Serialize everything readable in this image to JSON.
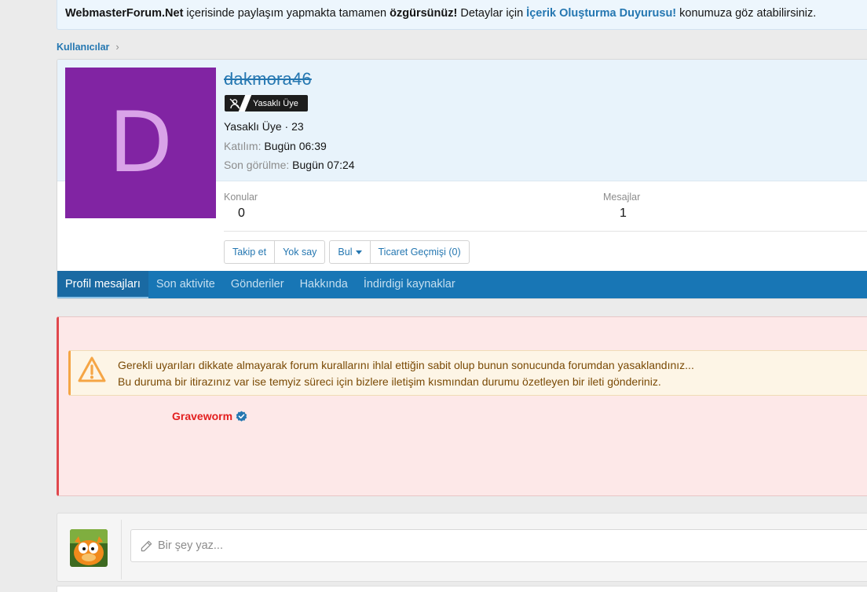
{
  "notice": {
    "site": "WebmasterForum.Net",
    "t1": " içerisinde paylaşım yapmakta tamamen ",
    "bold": "özgürsünüz!",
    "t2": " Detaylar için ",
    "link": "İçerik Oluşturma Duyurusu!",
    "t3": " konumuza göz atabilirsiniz."
  },
  "breadcrumb": {
    "item": "Kullanıcılar",
    "chevron": "›"
  },
  "profile": {
    "avatar_letter": "D",
    "avatar_color": "#8124a3",
    "username": "dakmora46",
    "badge": "Yasaklı Üye",
    "title_line": "Yasaklı Üye · 23",
    "joined_label": "Katılım:",
    "joined_value": "Bugün 06:39",
    "lastseen_label": "Son görülme:",
    "lastseen_value": "Bugün 07:24",
    "stats": [
      {
        "label": "Konular",
        "value": "0"
      },
      {
        "label": "Mesajlar",
        "value": "1"
      }
    ],
    "buttons": {
      "follow": "Takip et",
      "ignore": "Yok say",
      "find": "Bul",
      "trade": "Ticaret Geçmişi (0)"
    },
    "tabs": [
      "Profil mesajları",
      "Son aktivite",
      "Gönderiler",
      "Hakkında",
      "İndirdigi kaynaklar"
    ]
  },
  "ban": {
    "line1": "Gerekli uyarıları dikkate almayarak forum kurallarını ihlal ettiğin sabit olup bunun sonucunda forumdan yasaklandınız...",
    "line2": "Bu duruma bir itirazınız var ise temyiz süreci için bizlere iletişim kısmından durumu özetleyen bir ileti gönderiniz.",
    "signature": "Graveworm"
  },
  "reply": {
    "placeholder": "Bir şey yaz..."
  },
  "colors": {
    "accent": "#2577b1",
    "tab_bar": "#1876b5",
    "ban_border": "#e0484d",
    "warning_border": "#f5a545",
    "signature": "#e31f1f"
  }
}
